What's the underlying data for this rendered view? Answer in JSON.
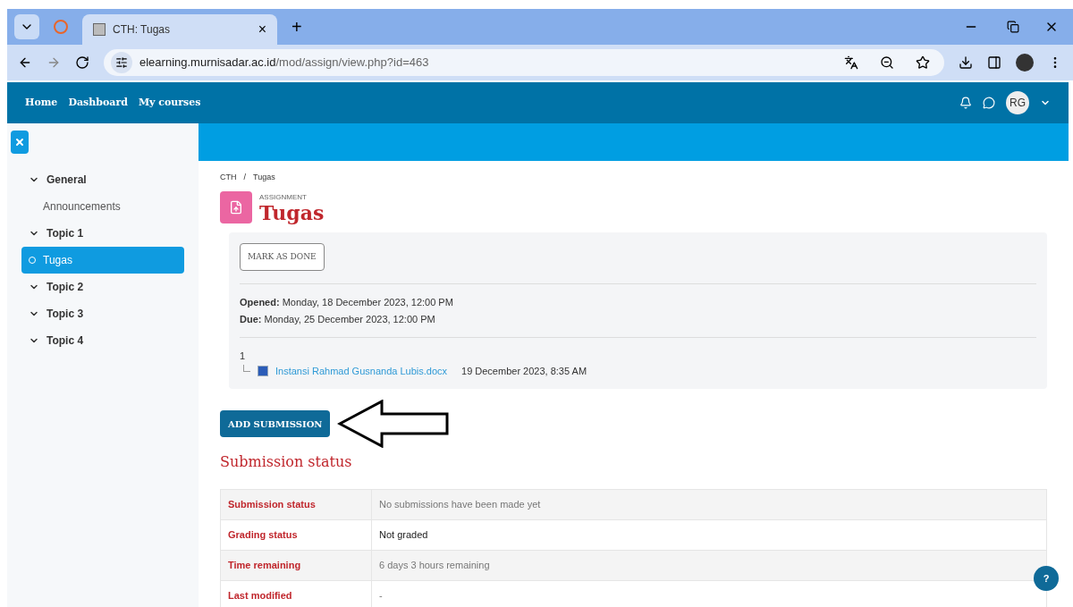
{
  "browser": {
    "tabs": [
      {
        "title": "CTH: Tugas",
        "selected": true,
        "close": "×"
      }
    ],
    "new_tab": "+",
    "url": {
      "host": "elearning.murnisadar.ac.id",
      "path": "/mod/assign/view.php?id=463"
    }
  },
  "navbar": {
    "links": [
      "Home",
      "Dashboard",
      "My courses"
    ],
    "avatar": "RG"
  },
  "sidebar": {
    "items": [
      {
        "label": "General",
        "children": [
          {
            "label": "Announcements",
            "selected": false
          }
        ]
      },
      {
        "label": "Topic 1",
        "children": [
          {
            "label": "Tugas",
            "selected": true
          }
        ]
      },
      {
        "label": "Topic 2"
      },
      {
        "label": "Topic 3"
      },
      {
        "label": "Topic 4"
      }
    ]
  },
  "breadcrumb": {
    "items": [
      "CTH",
      "Tugas"
    ],
    "separator": "/"
  },
  "activity": {
    "type": "ASSIGNMENT",
    "title": "Tugas"
  },
  "mark_done": "MARK AS DONE",
  "dates": [
    {
      "label": "Opened:",
      "value": "Monday, 18 December 2023, 12:00 PM"
    },
    {
      "label": "Due:",
      "value": "Monday, 25 December 2023, 12:00 PM"
    }
  ],
  "attachments": {
    "heading": "1",
    "files": [
      {
        "name": "Instansi Rahmad Gusnanda Lubis.docx",
        "date": "19 December 2023, 8:35 AM"
      }
    ]
  },
  "add_submission": "ADD SUBMISSION",
  "status_title": "Submission status",
  "status_rows": [
    {
      "label": "Submission status",
      "value": "No submissions have been made yet",
      "kind": "muted"
    },
    {
      "label": "Grading status",
      "value": "Not graded",
      "kind": "plain"
    },
    {
      "label": "Time remaining",
      "value": "6 days 3 hours remaining",
      "kind": "muted"
    },
    {
      "label": "Last modified",
      "value": "-",
      "kind": "muted"
    }
  ],
  "help": "?"
}
